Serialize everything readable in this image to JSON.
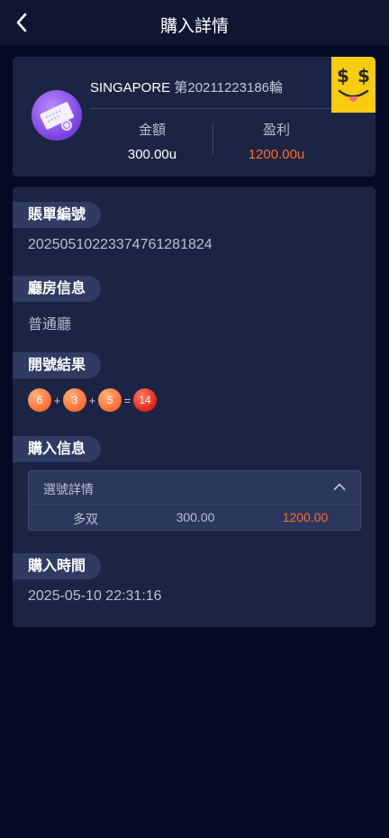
{
  "header": {
    "title": "購入詳情"
  },
  "summary": {
    "room_name": "SINGAPORE",
    "issue": "第20211223186輪",
    "amount_label": "金額",
    "amount_value": "300.00u",
    "profit_label": "盈利",
    "profit_value": "1200.00u",
    "profit_color": "#ff6a2e"
  },
  "sections": {
    "order_no": {
      "label": "賬單編號",
      "value": "2025051022337476128182​4"
    },
    "room_info": {
      "label": "廳房信息",
      "value": "普通廳"
    },
    "draw_result": {
      "label": "開號結果",
      "balls": [
        "6",
        "3",
        "5"
      ],
      "ops": [
        "+",
        "+",
        "="
      ],
      "sum": "14"
    },
    "purchase_info": {
      "label": "購入信息",
      "box_title": "選號詳情",
      "row": {
        "bet": "多双",
        "amount": "300.00",
        "profit": "1200.00"
      }
    },
    "purchase_time": {
      "label": "購入時間",
      "value": "2025-05-10 22:31:16"
    }
  },
  "colors": {
    "accent": "#ff6a2e",
    "background": "#050a24",
    "card": "#1b2543"
  },
  "icons": {
    "back": "chevron-left-icon",
    "collapse": "chevron-up-icon",
    "room": "lottery-ticket-icon",
    "badge": "money-eyes-emoji-icon"
  }
}
